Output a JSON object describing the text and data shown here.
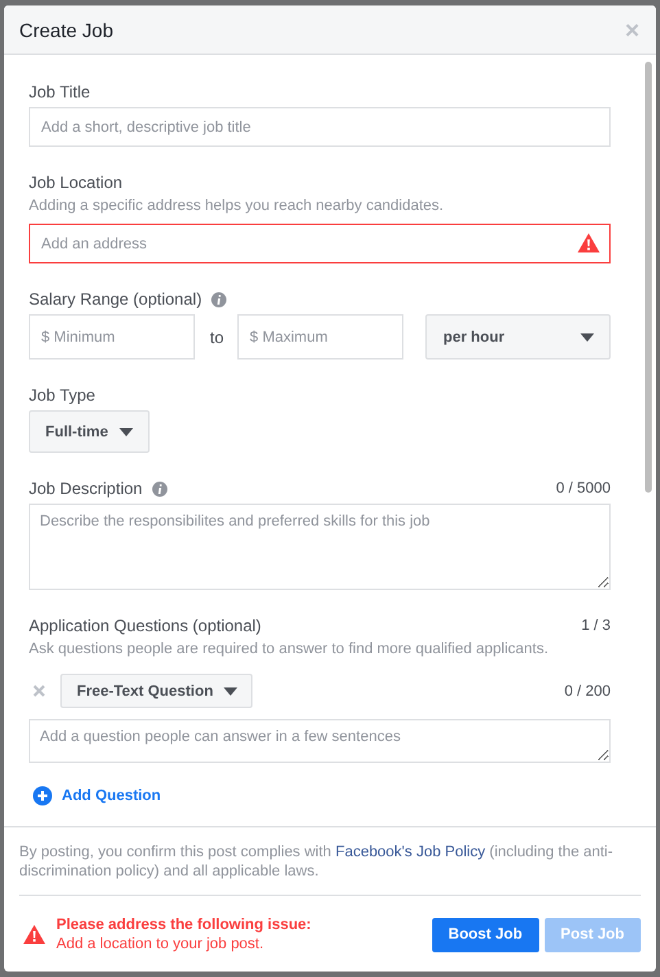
{
  "dialog": {
    "title": "Create Job",
    "close": "×"
  },
  "job_title": {
    "label": "Job Title",
    "placeholder": "Add a short, descriptive job title"
  },
  "job_location": {
    "label": "Job Location",
    "hint": "Adding a specific address helps you reach nearby candidates.",
    "placeholder": "Add an address",
    "error": true
  },
  "salary": {
    "label": "Salary Range (optional)",
    "min_placeholder": "$ Minimum",
    "separator": "to",
    "max_placeholder": "$ Maximum",
    "period": "per hour"
  },
  "job_type": {
    "label": "Job Type",
    "value": "Full-time"
  },
  "job_description": {
    "label": "Job Description",
    "counter": "0 / 5000",
    "placeholder": "Describe the responsibilites and preferred skills for this job"
  },
  "application_questions": {
    "label": "Application Questions (optional)",
    "counter": "1 / 3",
    "hint": "Ask questions people are required to answer to find more qualified applicants.",
    "questions": [
      {
        "type": "Free-Text Question",
        "counter": "0 / 200",
        "placeholder": "Add a question people can answer in a few sentences"
      }
    ],
    "add_label": "Add Question"
  },
  "policy": {
    "before": "By posting, you confirm this post complies with ",
    "link": "Facebook's Job Policy",
    "after": " (including the anti-discrimination policy) and all applicable laws."
  },
  "error": {
    "title": "Please address the following issue:",
    "message": "Add a location to your job post."
  },
  "buttons": [
    {
      "label": "Boost Job",
      "disabled": false
    },
    {
      "label": "Post Job",
      "disabled": true
    }
  ]
}
